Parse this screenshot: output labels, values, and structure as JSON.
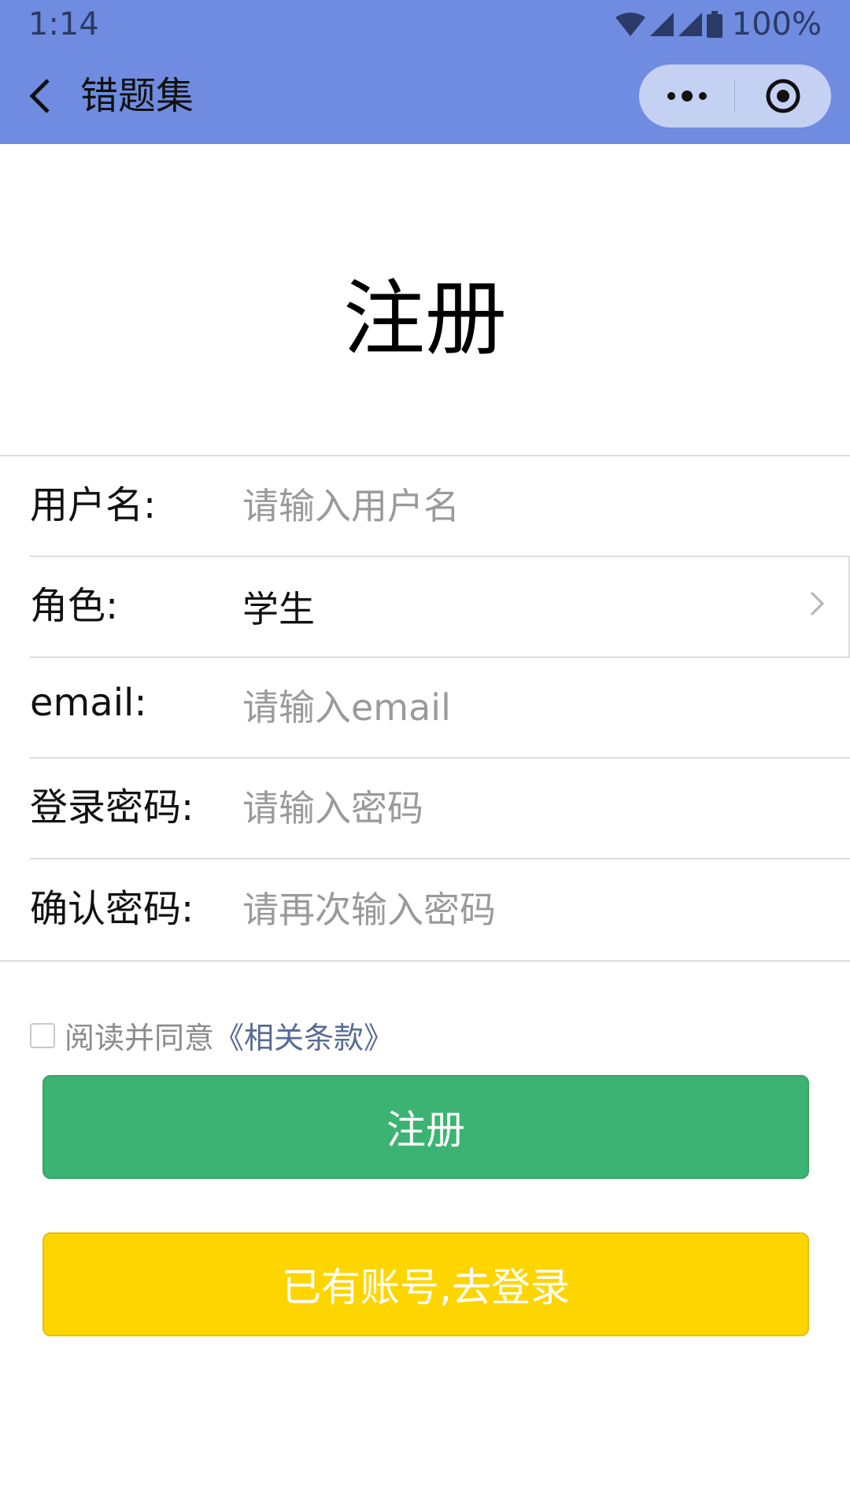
{
  "status_bar": {
    "time": "1:14",
    "battery": "100%",
    "icons": [
      "wifi-icon",
      "signal-icon",
      "signal-icon",
      "battery-icon"
    ]
  },
  "nav": {
    "title": "错题集",
    "back_icon": "chevron-left-icon",
    "more_icon": "more-dots-icon",
    "close_icon": "target-circle-icon"
  },
  "page": {
    "heading": "注册"
  },
  "form": {
    "username": {
      "label": "用户名:",
      "placeholder": "请输入用户名"
    },
    "role": {
      "label": "角色:",
      "value": "学生"
    },
    "email": {
      "label": "email:",
      "placeholder": "请输入email"
    },
    "password": {
      "label": "登录密码:",
      "placeholder": "请输入密码"
    },
    "confirm": {
      "label": "确认密码:",
      "placeholder": "请再次输入密码"
    }
  },
  "agreement": {
    "text": "阅读并同意",
    "link": "《相关条款》"
  },
  "buttons": {
    "register": "注册",
    "login": "已有账号,去登录"
  },
  "colors": {
    "nav_bg": "#6f8ce0",
    "register_btn": "#3cb372",
    "login_btn": "#ffd500",
    "link": "#576b95"
  }
}
